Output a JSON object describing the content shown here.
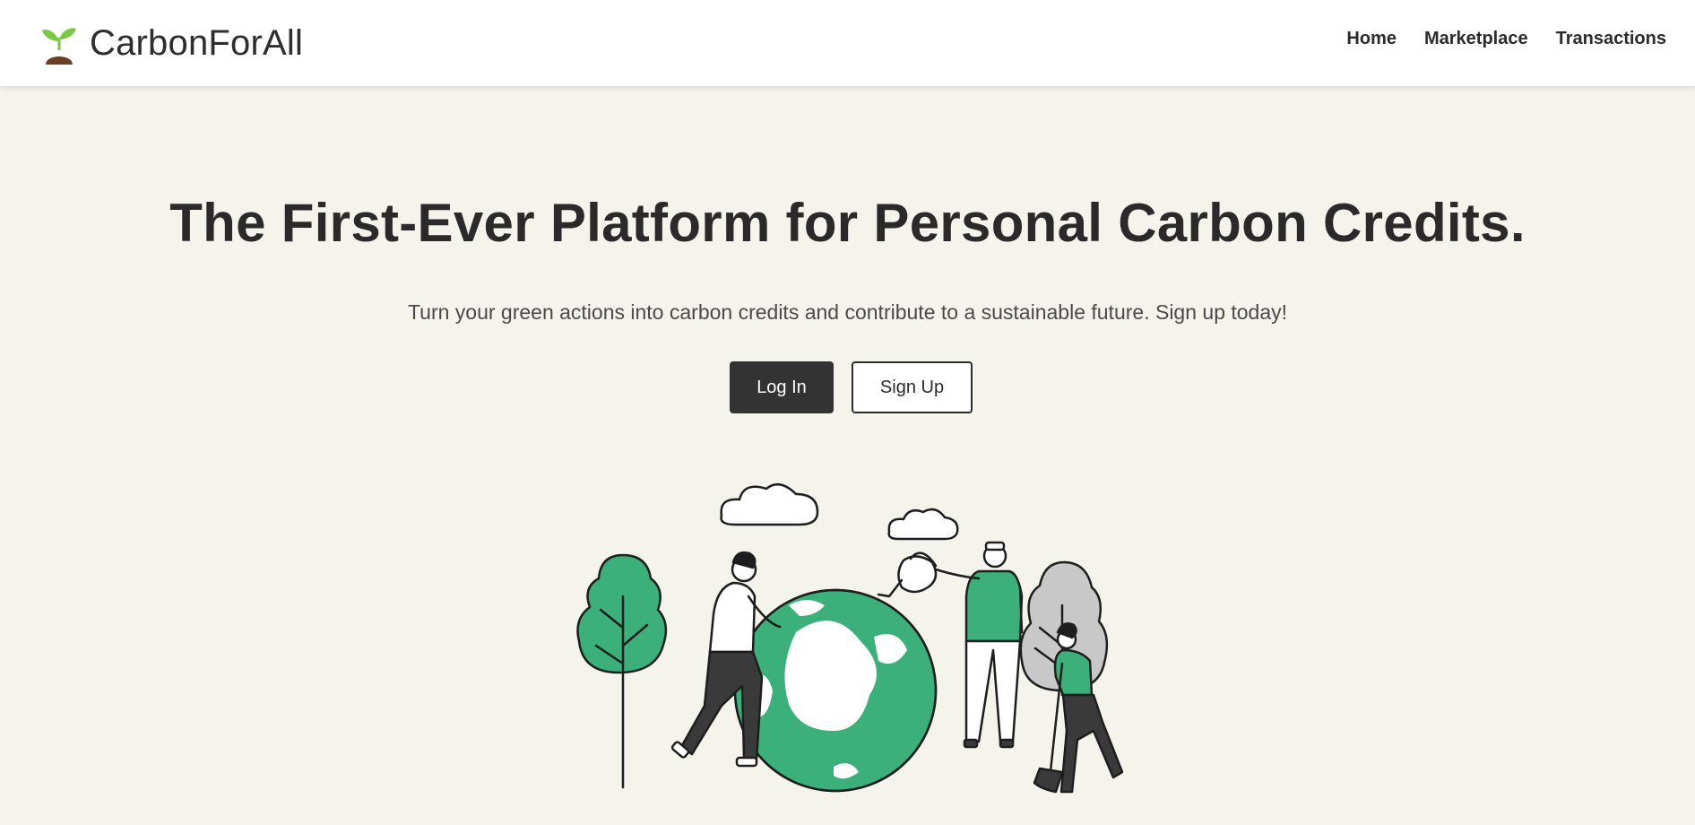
{
  "brand": {
    "name": "CarbonForAll",
    "icon": "sprout-icon"
  },
  "nav": {
    "items": [
      {
        "label": "Home"
      },
      {
        "label": "Marketplace"
      },
      {
        "label": "Transactions"
      }
    ]
  },
  "hero": {
    "title": "The First-Ever Platform for Personal Carbon Credits.",
    "subtitle": "Turn your green actions into carbon credits and contribute to a sustainable future. Sign up today!",
    "login_label": "Log In",
    "signup_label": "Sign Up",
    "illustration": "people-caring-for-earth-illustration"
  },
  "colors": {
    "accent_green": "#3bb07a",
    "dark": "#333333",
    "background": "#f4f3ec",
    "sprout_green": "#7ac943",
    "soil_brown": "#6b3e26"
  }
}
